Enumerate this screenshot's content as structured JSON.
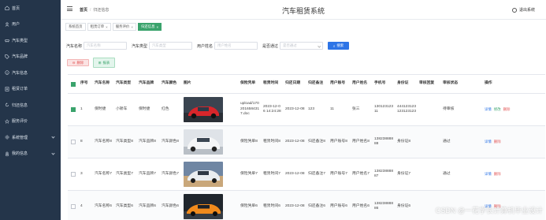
{
  "header": {
    "breadcrumb_home": "首页",
    "breadcrumb_current": "归还信息",
    "title": "汽车租赁系统",
    "logout": "退出系统"
  },
  "sidebar": {
    "items": [
      {
        "label": "首页",
        "icon": "home-icon"
      },
      {
        "label": "用户",
        "icon": "user-icon"
      },
      {
        "label": "汽车类型",
        "icon": "car-icon"
      },
      {
        "label": "汽车品牌",
        "icon": "tag-icon"
      },
      {
        "label": "汽车信息",
        "icon": "info-icon"
      },
      {
        "label": "租赁订单",
        "icon": "order-icon"
      },
      {
        "label": "归还信息",
        "icon": "return-icon"
      },
      {
        "label": "服务评价",
        "icon": "star-icon"
      },
      {
        "label": "系统管理",
        "icon": "gear-icon"
      },
      {
        "label": "我的信息",
        "icon": "person-icon"
      }
    ]
  },
  "tabs": [
    {
      "label": "系统首页",
      "closable": false
    },
    {
      "label": "租赁订单",
      "closable": true
    },
    {
      "label": "服务评价",
      "closable": true
    },
    {
      "label": "归还信息",
      "closable": true,
      "active": true
    }
  ],
  "search": {
    "car_name_label": "汽车名称",
    "car_name_placeholder": "汽车名称",
    "car_type_label": "汽车类型",
    "car_type_placeholder": "汽车类型",
    "username_label": "用户姓名",
    "username_placeholder": "用户姓名",
    "approved_label": "是否通过",
    "approved_placeholder": "是否通过",
    "search_button": "搜索"
  },
  "actions": {
    "delete": "删除",
    "report": "报表"
  },
  "table": {
    "headers": [
      "序号",
      "汽车名称",
      "汽车类型",
      "汽车品牌",
      "汽车颜色",
      "图片",
      "保险凭单",
      "租赁时间",
      "归还日期",
      "归还备注",
      "用户账号",
      "用户姓名",
      "手机号",
      "身份证",
      "审核回复",
      "审核状态",
      "操作"
    ],
    "ops": {
      "view": "详情",
      "edit": "修改",
      "delete": "删除"
    },
    "rows": [
      {
        "checked": true,
        "cells": [
          "1",
          "保时捷",
          "小轿车",
          "保时捷",
          "红色",
          "",
          "upload/1702016584317.doc",
          "2023-12-06 14:24:28",
          "2023-12-08",
          "123",
          "11",
          "张三",
          "13012312311",
          "444123123123123123",
          "",
          "待审核"
        ],
        "photo_color": "red",
        "editable": true
      },
      {
        "checked": false,
        "cells": [
          "8",
          "汽车名称8",
          "汽车类型8",
          "汽车品牌8",
          "汽车颜色8",
          "",
          "保险凭单8",
          "租赁时间8",
          "2023-12-08",
          "归还备注8",
          "用户账号8",
          "用户姓名8",
          "13823888888",
          "身份证8",
          "",
          "通过"
        ],
        "photo_color": "white",
        "editable": false
      },
      {
        "checked": false,
        "cells": [
          "3",
          "汽车名称7",
          "汽车类型7",
          "汽车品牌7",
          "汽车颜色7",
          "",
          "保险凭单7",
          "租赁时间7",
          "2023-12-08",
          "归还备注7",
          "用户账号7",
          "用户姓名7",
          "13823888887",
          "身份证7",
          "",
          "通过"
        ],
        "photo_color": "tan",
        "editable": false
      },
      {
        "checked": false,
        "cells": [
          "4",
          "汽车名称6",
          "汽车类型6",
          "汽车品牌6",
          "汽车颜色6",
          "",
          "保险凭单6",
          "租赁时间6",
          "2023-12-08",
          "归还备注6",
          "用户账号6",
          "用户姓名6",
          "13823888886",
          "身份证6",
          "",
          ""
        ],
        "photo_color": "orange",
        "editable": false
      }
    ]
  },
  "watermark": "CSDN @一花学长计算机毕业设计",
  "colors": {
    "sidebar_bg": "#24354a",
    "accent_green": "#3aa36c",
    "primary_blue": "#2d74e6",
    "danger_red": "#e25353"
  }
}
